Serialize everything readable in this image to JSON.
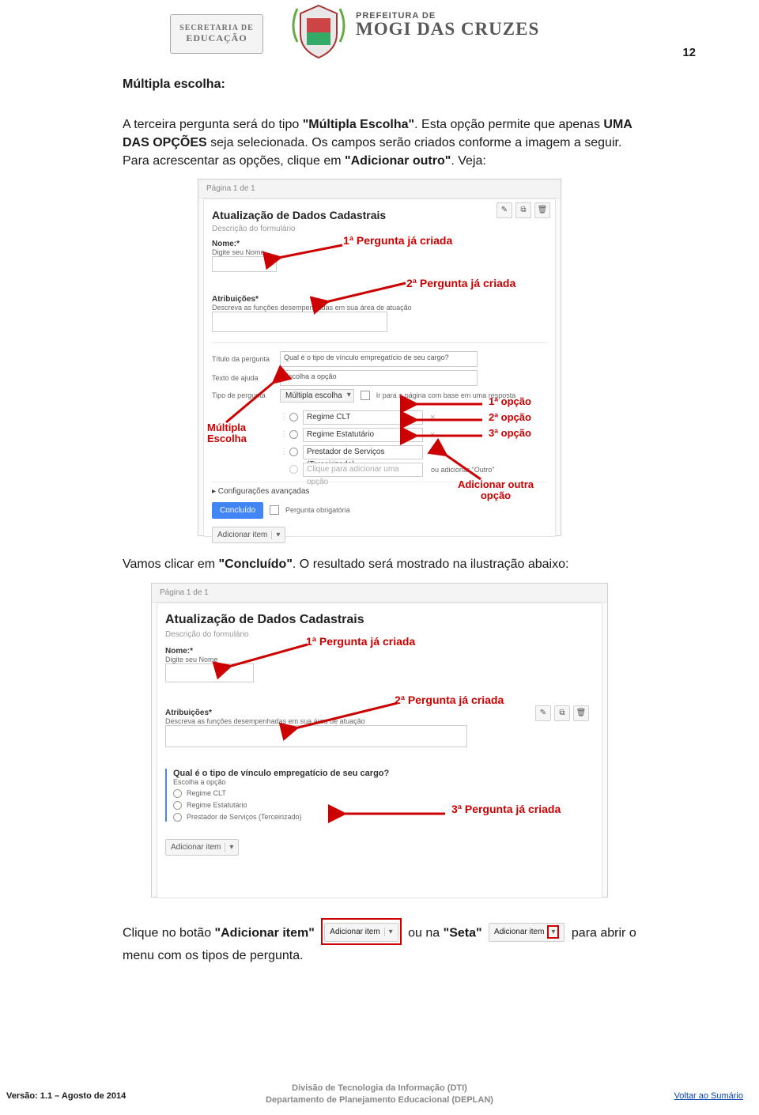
{
  "header": {
    "secretaria_l1": "SECRETARIA DE",
    "secretaria_l2": "EDUCAÇÃO",
    "prefeitura_l1": "PREFEITURA DE",
    "prefeitura_l2": "MOGI DAS CRUZES",
    "page_number": "12"
  },
  "heading": "Múltipla escolha:",
  "paragraph1_a": "A terceira pergunta será do tipo ",
  "paragraph1_b": "\"Múltipla Escolha\"",
  "paragraph1_c": ". Esta opção permite que apenas ",
  "paragraph1_d": "UMA DAS OPÇÕES",
  "paragraph1_e": " seja selecionada. Os campos serão criados conforme a imagem a seguir. Para acrescentar as opções, clique em ",
  "paragraph1_f": "\"Adicionar outro\"",
  "paragraph1_g": ". Veja:",
  "form1": {
    "page": "Página 1 de 1",
    "title": "Atualização de Dados Cadastrais",
    "desc": "Descrição do formulário",
    "q1_label": "Nome:*",
    "q1_help": "Digite seu Nome",
    "q2_label": "Atribuições*",
    "q2_help": "Descreva as funções desempenhadas em sua área de atuação",
    "q3_labels": {
      "titulo": "Título da pergunta",
      "ajuda": "Texto de ajuda",
      "tipo": "Tipo de pergunta"
    },
    "q3_values": {
      "titulo": "Qual é o tipo de vínculo empregatício de seu cargo?",
      "ajuda": "Escolha a opção",
      "tipo": "Múltipla escolha",
      "go_checkbox": "Ir para a página com base em uma resposta"
    },
    "options": [
      "Regime CLT",
      "Regime Estatutário",
      "Prestador de Serviços (Terceirizado)"
    ],
    "opt_placeholder": "Clique para adicionar uma opção",
    "or_add": "ou adicionar \"Outro\"",
    "adv": "▸ Configurações avançadas",
    "done": "Concluído",
    "required": "Pergunta obrigatória",
    "add_item": "Adicionar item"
  },
  "annotations1": {
    "q1": "1ª Pergunta já criada",
    "q2": "2ª Pergunta já criada",
    "opt1": "1ª opção",
    "opt2": "2ª opção",
    "opt3": "3ª opção",
    "mult": "Múltipla Escolha",
    "addopt": "Adicionar outra opção"
  },
  "paragraph2_a": "Vamos clicar em ",
  "paragraph2_b": "\"Concluído\"",
  "paragraph2_c": ". O resultado será mostrado na ilustração abaixo:",
  "form2": {
    "page": "Página 1 de 1",
    "title": "Atualização de Dados Cadastrais",
    "desc": "Descrição do formulário",
    "q1_label": "Nome:*",
    "q1_help": "Digite seu Nome",
    "q2_label": "Atribuições*",
    "q2_help": "Descreva as funções desempenhadas em sua área de atuação",
    "q3_title": "Qual é o tipo de vínculo empregatício de seu cargo?",
    "q3_help": "Escolha a opção",
    "options": [
      "Regime CLT",
      "Regime Estatutário",
      "Prestador de Serviços (Terceirizado)"
    ],
    "add_item": "Adicionar item"
  },
  "annotations2": {
    "q1": "1ª Pergunta já criada",
    "q2": "2ª Pergunta já criada",
    "q3": "3ª Pergunta já criada"
  },
  "paragraph3": {
    "a": "Clique no botão ",
    "b": "\"Adicionar item\"",
    "c": " ou na ",
    "d": "\"Seta\"",
    "e": " para abrir o menu com os tipos de pergunta.",
    "btn_label": "Adicionar item"
  },
  "footer": {
    "version": "Versão: 1.1 – Agosto de 2014",
    "line1": "Divisão de Tecnologia da Informação (DTI)",
    "line2": "Departamento de Planejamento Educacional (DEPLAN)",
    "link": "Voltar ao Sumário"
  }
}
